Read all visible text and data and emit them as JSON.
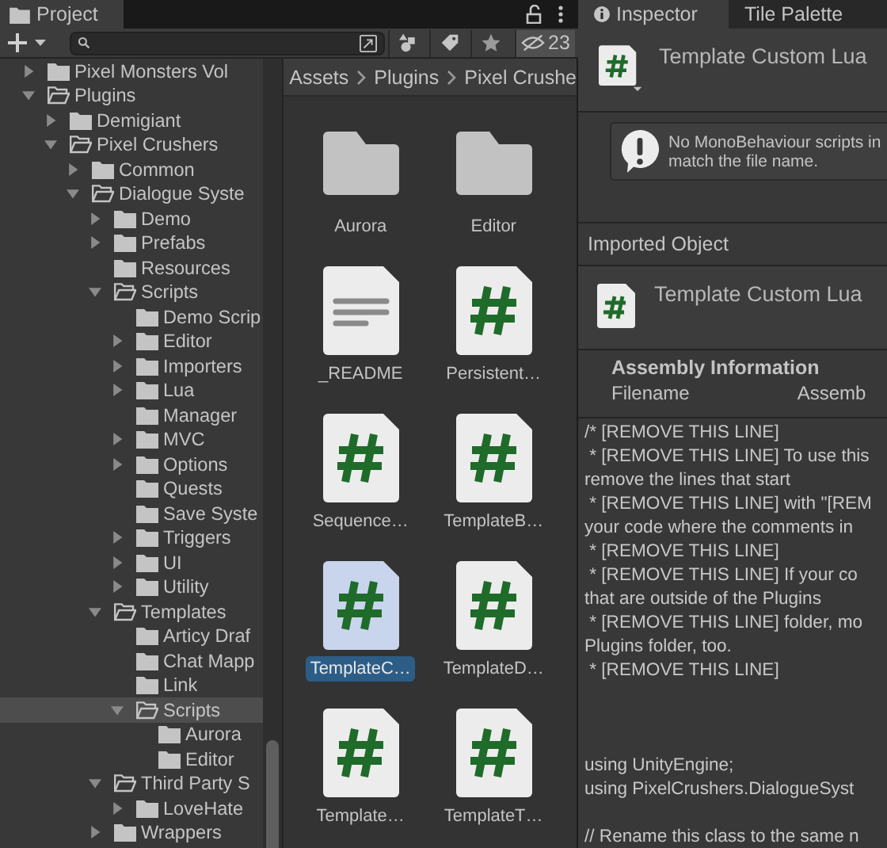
{
  "project_panel": {
    "tab": {
      "label": "Project",
      "selected": true
    },
    "toolbar": {
      "hidden_count": "23"
    },
    "tree": [
      {
        "name": "Pixel Monsters Vol",
        "expandable": true,
        "expanded": false,
        "selected": false
      },
      {
        "name": "Plugins",
        "expandable": true,
        "expanded": true,
        "selected": false,
        "children": [
          {
            "name": "Demigiant",
            "expandable": true,
            "expanded": false,
            "selected": false
          },
          {
            "name": "Pixel Crushers",
            "expandable": true,
            "expanded": true,
            "selected": false,
            "children": [
              {
                "name": "Common",
                "expandable": true,
                "expanded": false,
                "selected": false
              },
              {
                "name": "Dialogue Syste",
                "expandable": true,
                "expanded": true,
                "selected": false,
                "children": [
                  {
                    "name": "Demo",
                    "expandable": true,
                    "expanded": false,
                    "selected": false
                  },
                  {
                    "name": "Prefabs",
                    "expandable": true,
                    "expanded": false,
                    "selected": false
                  },
                  {
                    "name": "Resources",
                    "expandable": false,
                    "expanded": false,
                    "selected": false
                  },
                  {
                    "name": "Scripts",
                    "expandable": true,
                    "expanded": true,
                    "selected": false,
                    "children": [
                      {
                        "name": "Demo Scrip",
                        "expandable": false,
                        "expanded": false,
                        "selected": false
                      },
                      {
                        "name": "Editor",
                        "expandable": true,
                        "expanded": false,
                        "selected": false
                      },
                      {
                        "name": "Importers",
                        "expandable": true,
                        "expanded": false,
                        "selected": false
                      },
                      {
                        "name": "Lua",
                        "expandable": true,
                        "expanded": false,
                        "selected": false
                      },
                      {
                        "name": "Manager",
                        "expandable": false,
                        "expanded": false,
                        "selected": false
                      },
                      {
                        "name": "MVC",
                        "expandable": true,
                        "expanded": false,
                        "selected": false
                      },
                      {
                        "name": "Options",
                        "expandable": true,
                        "expanded": false,
                        "selected": false
                      },
                      {
                        "name": "Quests",
                        "expandable": false,
                        "expanded": false,
                        "selected": false
                      },
                      {
                        "name": "Save Syste",
                        "expandable": false,
                        "expanded": false,
                        "selected": false
                      },
                      {
                        "name": "Triggers",
                        "expandable": true,
                        "expanded": false,
                        "selected": false
                      },
                      {
                        "name": "UI",
                        "expandable": true,
                        "expanded": false,
                        "selected": false
                      },
                      {
                        "name": "Utility",
                        "expandable": true,
                        "expanded": false,
                        "selected": false
                      }
                    ]
                  },
                  {
                    "name": "Templates",
                    "expandable": true,
                    "expanded": true,
                    "selected": false,
                    "children": [
                      {
                        "name": "Articy Draf",
                        "expandable": false,
                        "expanded": false,
                        "selected": false
                      },
                      {
                        "name": "Chat Mapp",
                        "expandable": false,
                        "expanded": false,
                        "selected": false
                      },
                      {
                        "name": "Link",
                        "expandable": false,
                        "expanded": false,
                        "selected": false
                      },
                      {
                        "name": "Scripts",
                        "expandable": true,
                        "expanded": true,
                        "selected": true,
                        "children": [
                          {
                            "name": "Aurora",
                            "expandable": false,
                            "expanded": false,
                            "selected": false
                          },
                          {
                            "name": "Editor",
                            "expandable": false,
                            "expanded": false,
                            "selected": false
                          }
                        ]
                      }
                    ]
                  },
                  {
                    "name": "Third Party S",
                    "expandable": true,
                    "expanded": true,
                    "selected": false,
                    "children": [
                      {
                        "name": "LoveHate",
                        "expandable": true,
                        "expanded": false,
                        "selected": false
                      }
                    ]
                  },
                  {
                    "name": "Wrappers",
                    "expandable": true,
                    "expanded": false,
                    "selected": false
                  }
                ]
              }
            ]
          }
        ]
      }
    ],
    "breadcrumbs": [
      "Assets",
      "Plugins",
      "Pixel Crushe"
    ],
    "assets": [
      {
        "name": "Aurora",
        "kind": "folder",
        "selected": false
      },
      {
        "name": "Editor",
        "kind": "folder",
        "selected": false
      },
      {
        "name": "_README",
        "kind": "text",
        "selected": false
      },
      {
        "name": "Persistent…",
        "kind": "script",
        "selected": false
      },
      {
        "name": "Sequence…",
        "kind": "script",
        "selected": false
      },
      {
        "name": "TemplateB…",
        "kind": "script",
        "selected": false
      },
      {
        "name": "TemplateC…",
        "kind": "script",
        "selected": true
      },
      {
        "name": "TemplateD…",
        "kind": "script",
        "selected": false
      },
      {
        "name": "Template…",
        "kind": "script",
        "selected": false
      },
      {
        "name": "TemplateT…",
        "kind": "script",
        "selected": false
      }
    ]
  },
  "inspector": {
    "tabs": [
      {
        "label": "Inspector",
        "selected": true
      },
      {
        "label": "Tile Palette",
        "selected": false
      }
    ],
    "title": "Template Custom Lua",
    "help_lines": [
      "No MonoBehaviour scripts in",
      "match the file name."
    ],
    "imported_object_label": "Imported Object",
    "imported_title": "Template Custom Lua",
    "assembly_heading": "Assembly Information",
    "assembly_columns": [
      "Filename",
      "Assemb"
    ],
    "code": "/* [REMOVE THIS LINE]\n * [REMOVE THIS LINE] To use this\nremove the lines that start\n * [REMOVE THIS LINE] with \"[REM\nyour code where the comments in\n * [REMOVE THIS LINE]\n * [REMOVE THIS LINE] If your co\nthat are outside of the Plugins\n * [REMOVE THIS LINE] folder, mo\nPlugins folder, too.\n * [REMOVE THIS LINE]\n\n\n\nusing UnityEngine;\nusing PixelCrushers.DialogueSyst\n\n// Rename this class to the same n"
  }
}
